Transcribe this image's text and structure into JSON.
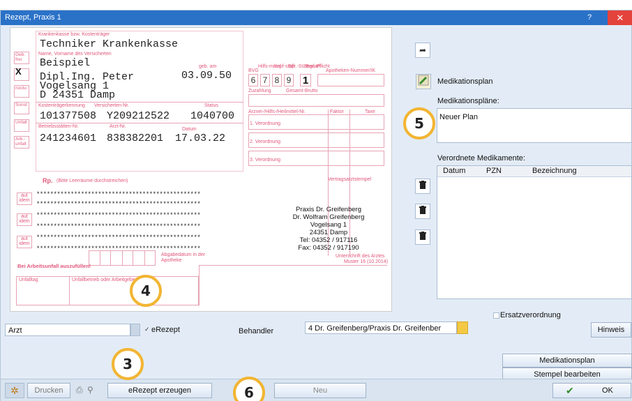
{
  "window": {
    "title": "Rezept, Praxis 1",
    "help": "?",
    "close": "✕"
  },
  "form": {
    "kasse_label": "Krankenkasse bzw. Kostenträger",
    "kasse": "Techniker Krankenkasse",
    "name_label": "Name, Vorname des Versicherten",
    "name1": "Beispiel",
    "name2": "Dipl.Ing. Peter",
    "street": "Vogelsang 1",
    "city": "D 24351 Damp",
    "geb_label": "geb. am",
    "geb": "03.09.50",
    "kennung_label": "Kostenträgerkennung",
    "versnr_label": "Versicherten-Nr.",
    "status_label": "Status",
    "kennung": "101377508",
    "versnr": "Y209212522",
    "status": "1040700",
    "bsnr_label": "Betriebsstätten-Nr.",
    "arztnr_label": "Arzt-Nr.",
    "datum_label": "Datum",
    "bsnr": "241234601",
    "arztnr": "838382201",
    "datum": "17.03.22",
    "side_gebfrei": "Geb. frei",
    "side_noctu": "noctu",
    "side_sonst": "Sonst",
    "side_unfall": "Unfall",
    "side_arbunfall": "Arb.-unfall",
    "x_mark": "X",
    "hilfsmittel_label": "Hilfs-mittel",
    "impfstoff_label": "Impf-stoff",
    "spr_label": "Spr.-St. Bedarf",
    "begr_label": "Begr.-Pflicht",
    "apotheken_label": "Apotheken-Nummer/IK",
    "bvg_label": "BVG",
    "digits": [
      "6",
      "7",
      "8",
      "9"
    ],
    "begr_value": "1",
    "zuzahlung_label": "Zuzahlung",
    "gesamt_label": "Gesamt-Brutto",
    "arznei_label": "Arznei-/Hilfs-/Heilmittel-Nr.",
    "faktor_label": "Faktor",
    "taxe_label": "Taxe",
    "vo1": "1. Verordnung",
    "vo2": "2. Verordnung",
    "vo3": "3. Verordnung",
    "rp_label": "Rp.",
    "rp_hint": "(Bitte Leerräume durchstreichen)",
    "vertragsarzt": "Vertragsarztstempel",
    "stars": "************************************************",
    "aut_idem": "aut idem",
    "doctor": [
      "Praxis Dr. Greifenberg",
      "Dr. Wolfram Greifenberg",
      "Vogelsang 1",
      "24351 Damp",
      "Tel: 04352 / 917116",
      "Fax: 04352 / 917190"
    ],
    "abgabe": "Abgabedatum in der Apotheke",
    "unterschrift": "Unterschrift des Arztes",
    "muster": "Muster 16 (10.2014)",
    "arbeitsunfall": "Bei Arbeitsunfall auszufüllen!",
    "unfalltag": "Unfalltag",
    "unfallbetrieb": "Unfallbetrieb oder Arbeitgebernummer"
  },
  "controls": {
    "arzt_value": "Arzt",
    "erezept_check": "✓",
    "erezept_label": "eRezept",
    "behandler_label": "Behandler",
    "behandler_value": "4 Dr. Greifenberg/Praxis Dr. Greifenber",
    "hinweis": "Hinweis",
    "ersatz_label": "Ersatzverordnung"
  },
  "right": {
    "share_icon": "➦",
    "medplan_label": "Medikationsplan",
    "medplaene_label": "Medikationspläne:",
    "plan_item": "Neuer Plan",
    "verordnete_label": "Verordnete Medikamente:",
    "columns": [
      "Datum",
      "PZN",
      "Bezeichnung"
    ],
    "medplan_button": "Medikationsplan",
    "stempel_button": "Stempel bearbeiten"
  },
  "bottom": {
    "drucken": "Drucken",
    "erezept_erzeugen": "eRezept erzeugen",
    "neu": "Neu",
    "ok": "OK",
    "ok_check": "✔"
  },
  "callouts": {
    "c3": "3",
    "c4": "4",
    "c5": "5",
    "c6": "6"
  },
  "colors": {
    "titlebar": "#2a72c8",
    "form_pink": "#e2577b",
    "callout": "#f2b533",
    "close": "#e4433c"
  }
}
